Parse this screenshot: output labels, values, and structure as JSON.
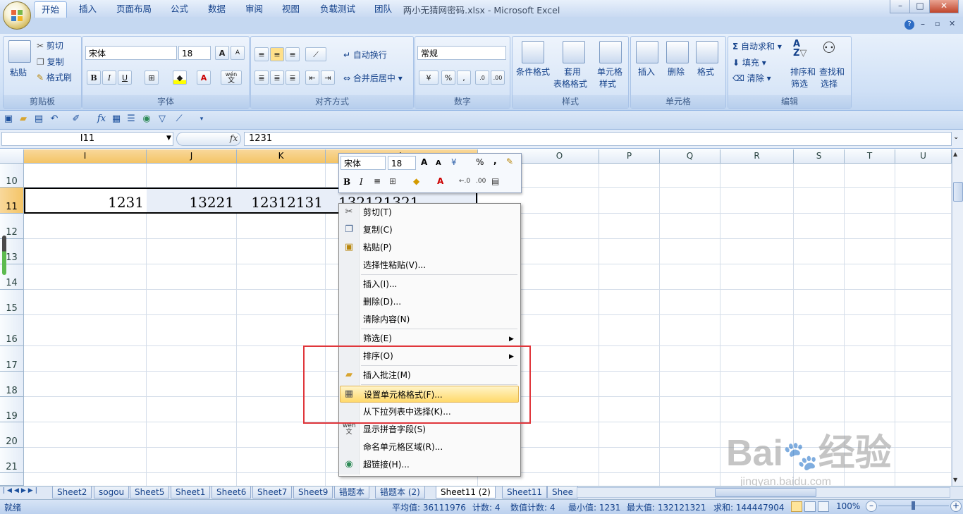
{
  "window": {
    "title": "两小无猜网密码.xlsx - Microsoft Excel",
    "min": "–",
    "max": "□",
    "close": "✕"
  },
  "ribbon_tabs": [
    "开始",
    "插入",
    "页面布局",
    "公式",
    "数据",
    "审阅",
    "视图",
    "负载测试",
    "团队"
  ],
  "ribbon": {
    "clipboard": {
      "label": "剪贴板",
      "paste": "粘贴",
      "cut": "剪切",
      "copy": "复制",
      "format_painter": "格式刷"
    },
    "font": {
      "label": "字体",
      "name": "宋体",
      "size": "18",
      "bold": "B",
      "italic": "I",
      "underline": "U",
      "grow": "A",
      "shrink": "A",
      "phonetic": "wén",
      "phonetic_char": "文"
    },
    "alignment": {
      "label": "对齐方式",
      "wrap": "自动换行",
      "merge": "合并后居中"
    },
    "number": {
      "label": "数字",
      "format": "常规",
      "percent": "%",
      "comma": ",",
      "inc": ".0",
      "dec": ".00"
    },
    "styles": {
      "label": "样式",
      "conditional": "条件格式",
      "table": "套用",
      "table2": "表格格式",
      "cell": "单元格",
      "cell2": "样式"
    },
    "cells": {
      "label": "单元格",
      "insert": "插入",
      "delete": "删除",
      "format": "格式"
    },
    "editing": {
      "label": "编辑",
      "autosum": "自动求和",
      "fill": "填充",
      "clear": "清除",
      "sort": "排序和",
      "sort2": "筛选",
      "find": "查找和",
      "find2": "选择",
      "sigma": "Σ",
      "az_top": "A",
      "az_bottom": "Z"
    }
  },
  "formula_bar": {
    "name_box": "I11",
    "fx": "fx",
    "value": "1231"
  },
  "columns": [
    "I",
    "J",
    "K",
    "L",
    "O",
    "P",
    "Q",
    "R",
    "S",
    "T",
    "U"
  ],
  "rows": [
    "10",
    "11",
    "12",
    "13",
    "14",
    "15",
    "16",
    "17",
    "18",
    "19",
    "20",
    "21"
  ],
  "cells": {
    "I11": "1231",
    "J11": "13221",
    "K11": "12312131",
    "L11": "132121321"
  },
  "mini_toolbar": {
    "font": "宋体",
    "size": "18",
    "bold": "B",
    "italic": "I",
    "percent": "%",
    "comma": ","
  },
  "context_menu": [
    {
      "label": "剪切(T)",
      "icon": "scissors-icon"
    },
    {
      "label": "复制(C)",
      "icon": "copy-icon"
    },
    {
      "label": "粘贴(P)",
      "icon": "paste-icon"
    },
    {
      "label": "选择性粘贴(V)..."
    },
    {
      "label": "插入(I)..."
    },
    {
      "label": "删除(D)..."
    },
    {
      "label": "清除内容(N)"
    },
    {
      "label": "筛选(E)",
      "submenu": true
    },
    {
      "label": "排序(O)",
      "submenu": true
    },
    {
      "label": "插入批注(M)",
      "icon": "comment-icon"
    },
    {
      "label": "设置单元格格式(F)...",
      "icon": "format-cells-icon",
      "highlighted": true
    },
    {
      "label": "从下拉列表中选择(K)..."
    },
    {
      "label": "显示拼音字段(S)",
      "icon": "phonetic-icon"
    },
    {
      "label": "命名单元格区域(R)..."
    },
    {
      "label": "超链接(H)...",
      "icon": "hyperlink-icon"
    }
  ],
  "sheet_tabs": [
    "Sheet2",
    "sogou",
    "Sheet5",
    "Sheet1",
    "Sheet6",
    "Sheet7",
    "Sheet9",
    "错题本",
    "错题本 (2)",
    "Sheet11 (2)",
    "Sheet11",
    "Shee"
  ],
  "active_sheet": "Sheet11 (2)",
  "status": {
    "ready": "就绪",
    "average": "平均值: 36111976",
    "count": "计数: 4",
    "numeric_count": "数值计数: 4",
    "min": "最小值: 1231",
    "max": "最大值: 132121321",
    "sum": "求和: 144447904",
    "zoom": "100%"
  },
  "watermark": {
    "text": "Bai",
    "text2": "经验",
    "url": "jingyan.baidu.com"
  },
  "colors": {
    "accent": "#15428b",
    "highlight": "#ffd96b",
    "annotation": "#e0363b"
  }
}
